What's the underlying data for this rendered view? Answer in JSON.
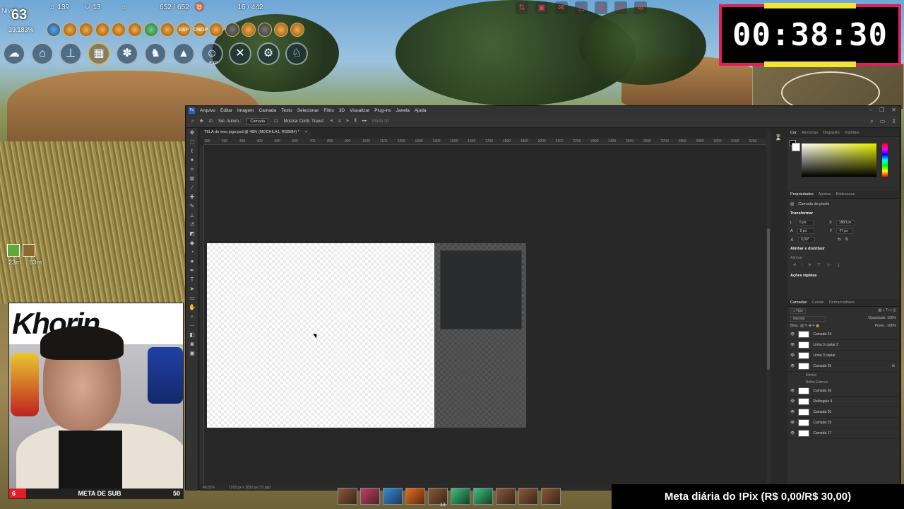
{
  "hud": {
    "level_label": "Nível",
    "level": "63",
    "xp_percent": "39.183%",
    "music_count": "139",
    "shield_count": "13",
    "hp": "652 / 652",
    "weight": "16 / 442",
    "boost_left": "23m",
    "boost_right": "83m",
    "buff_labels": [
      "EXP",
      "DROP"
    ],
    "skill_badge": "EXP"
  },
  "timer": {
    "value": "00:38:30"
  },
  "webcam": {
    "banner": "Khorin",
    "sub_count": "6",
    "sub_title": "META DE SUB",
    "sub_goal": "50"
  },
  "donation": {
    "text": "Meta diária do !Pix (R$ 0,00/R$ 30,00)"
  },
  "hotbar": {
    "badge": "13"
  },
  "photoshop": {
    "logo": "Ps",
    "menu": [
      "Arquivo",
      "Editar",
      "Imagem",
      "Camada",
      "Texto",
      "Selecionar",
      "Filtro",
      "3D",
      "Visualizar",
      "Plug-ins",
      "Janela",
      "Ajuda"
    ],
    "options": {
      "auto_select": "Sel. Autom.:",
      "auto_select_value": "Camada",
      "show_transform": "Mostrar Contr. Transf.",
      "mode": "Modo 3D:"
    },
    "tab_title": "TELA do meu jogo.psd @ 48% (MOCHILA1, RGB/8#) *",
    "ruler": [
      "100",
      "200",
      "300",
      "400",
      "500",
      "600",
      "700",
      "800",
      "900",
      "1000",
      "1100",
      "1200",
      "1300",
      "1400",
      "1500",
      "1600",
      "1700",
      "1800",
      "1900",
      "2000",
      "2100",
      "2200",
      "2300",
      "2400",
      "2500",
      "2600",
      "2700",
      "2800",
      "2900",
      "3000",
      "3100",
      "3200"
    ],
    "status": {
      "zoom": "48,01%",
      "dims": "1918 px x 1032 px (72 ppi)"
    },
    "panels": {
      "color_tabs": [
        "Cor",
        "Amostras",
        "Degradês",
        "Padrões"
      ],
      "prop_tabs": [
        "Propriedades",
        "Ajustes",
        "Bibliotecas"
      ],
      "layer_kind": "Camada de pixels",
      "transform_title": "Transformar",
      "w_label": "L",
      "w_value": "6 px",
      "h_label": "A",
      "h_value": "9 px",
      "x_label": "X",
      "x_value": "1880 px",
      "y_label": "Y",
      "y_value": "47 px",
      "angle": "0,00°",
      "align_title": "Alinhar e distribuir",
      "align_sub": "Alinhar:",
      "quick_title": "Ações rápidas",
      "layer_tabs": [
        "Camadas",
        "Canais",
        "Demarcadores"
      ],
      "filter_kind": "Tipo",
      "blend_mode": "Normal",
      "opacity_label": "Opacidade:",
      "opacity_value": "100%",
      "lock_label": "Bloq.:",
      "fill_label": "Preen.:",
      "fill_value": "100%",
      "layers": [
        {
          "name": "Camada 24"
        },
        {
          "name": "Linha 3 copiar 2"
        },
        {
          "name": "Linha 3 copiar"
        },
        {
          "name": "Camada 25",
          "fx": "fx"
        },
        {
          "name": "Efeitos",
          "sub": true
        },
        {
          "name": "Brilho Externo",
          "sub": true
        },
        {
          "name": "Camada 26"
        },
        {
          "name": "Retângulo 4"
        },
        {
          "name": "Camada 20"
        },
        {
          "name": "Camada 19"
        },
        {
          "name": "Camada 17"
        }
      ]
    }
  }
}
